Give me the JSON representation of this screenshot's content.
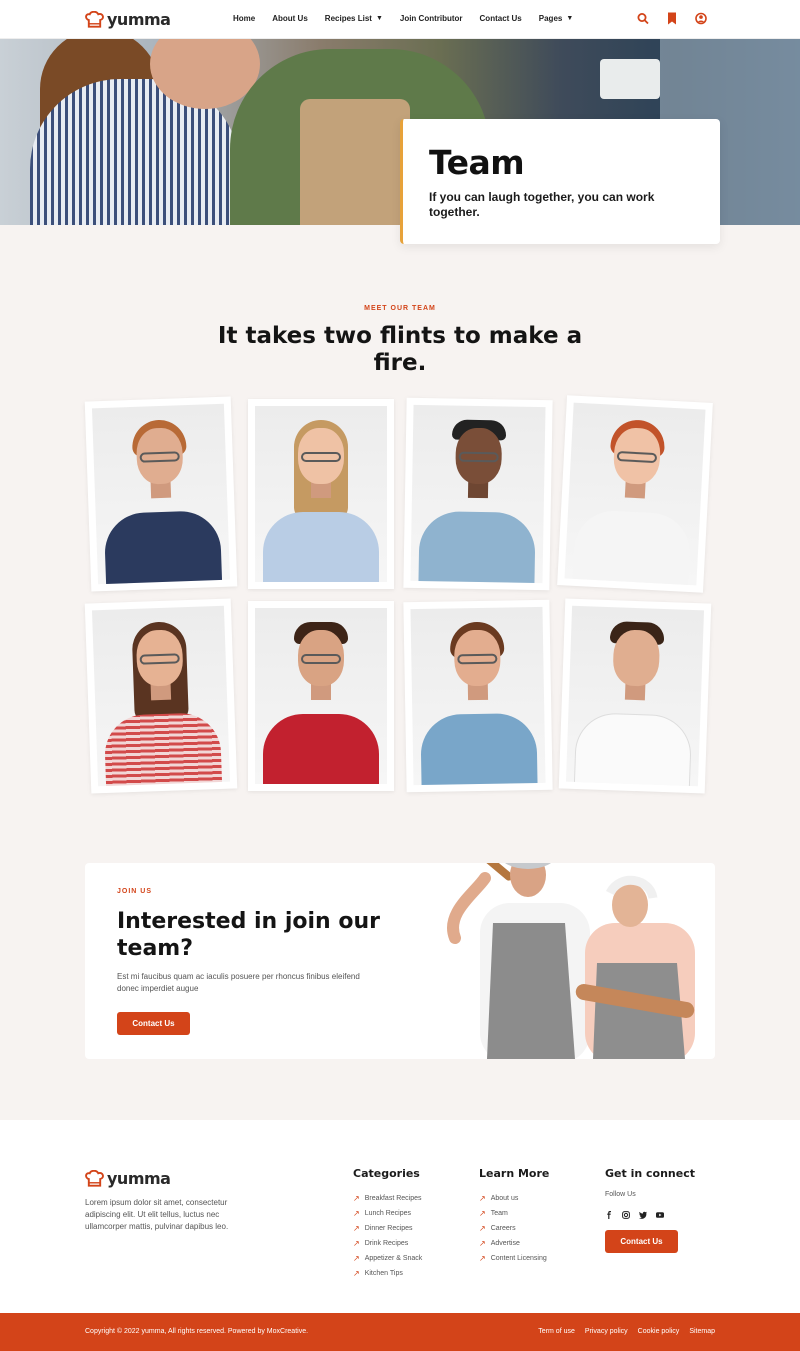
{
  "brand": {
    "name": "yumma"
  },
  "nav": {
    "items": [
      {
        "label": "Home"
      },
      {
        "label": "About Us"
      },
      {
        "label": "Recipes List",
        "dropdown": true
      },
      {
        "label": "Join Contributor"
      },
      {
        "label": "Contact Us"
      },
      {
        "label": "Pages",
        "dropdown": true
      }
    ],
    "icons": [
      "search-icon",
      "bookmark-icon",
      "user-icon"
    ]
  },
  "hero": {
    "title": "Team",
    "subtitle": "If you can laugh together, you can work together."
  },
  "team": {
    "eyebrow": "MEET OUR TEAM",
    "title": "It takes two flints to make a fire."
  },
  "join": {
    "eyebrow": "JOIN US",
    "title": "Interested in join our team?",
    "text": "Est mi faucibus quam ac iaculis posuere per rhoncus finibus eleifend donec imperdiet augue",
    "button": "Contact Us"
  },
  "footer": {
    "about": "Lorem ipsum dolor sit amet, consectetur adipiscing elit. Ut elit tellus, luctus nec ullamcorper mattis, pulvinar dapibus leo.",
    "categories": {
      "title": "Categories",
      "links": [
        "Breakfast Recipes",
        "Lunch Recipes",
        "Dinner Recipes",
        "Drink Recipes",
        "Appetizer & Snack",
        "Kitchen Tips"
      ]
    },
    "learn": {
      "title": "Learn More",
      "links": [
        "About us",
        "Team",
        "Careers",
        "Advertise",
        "Content Licensing"
      ]
    },
    "connect": {
      "title": "Get in connect",
      "follow": "Follow Us",
      "socials": [
        "facebook-icon",
        "instagram-icon",
        "twitter-icon",
        "youtube-icon"
      ],
      "button": "Contact Us"
    },
    "copyright": "Copyright © 2022 yumma, All rights reserved. Powered by MoxCreative.",
    "legal": [
      "Term of use",
      "Privacy policy",
      "Cookie policy",
      "Sitemap"
    ]
  },
  "colors": {
    "accent": "#d34419",
    "hero_border": "#e7a23a",
    "background": "#f7f3f1"
  }
}
